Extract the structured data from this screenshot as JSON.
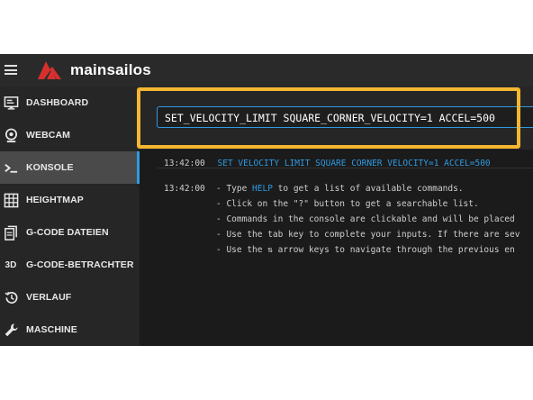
{
  "header": {
    "title": "mainsailos"
  },
  "sidebar": {
    "items": [
      {
        "label": "DASHBOARD",
        "icon": "dashboard-icon"
      },
      {
        "label": "WEBCAM",
        "icon": "webcam-icon"
      },
      {
        "label": "KONSOLE",
        "icon": "console-icon"
      },
      {
        "label": "HEIGHTMAP",
        "icon": "grid-icon"
      },
      {
        "label": "G-CODE DATEIEN",
        "icon": "files-icon"
      },
      {
        "label": "G-CODE-BETRACHTER",
        "icon": "3d-icon",
        "icon_text": "3D"
      },
      {
        "label": "VERLAUF",
        "icon": "history-icon"
      },
      {
        "label": "MASCHINE",
        "icon": "wrench-icon"
      }
    ]
  },
  "console": {
    "input_value": "SET_VELOCITY_LIMIT SQUARE_CORNER_VELOCITY=1 ACCEL=500",
    "entries": [
      {
        "time": "13:42:00",
        "command": "SET_VELOCITY_LIMIT SQUARE_CORNER_VELOCITY=1 ACCEL=500"
      },
      {
        "time": "13:42:00",
        "line1_prefix": "- Type ",
        "line1_kw": "HELP",
        "line1_suffix": " to get a list of available commands.",
        "line2": "- Click on the \"?\" button to get a searchable list.",
        "line3": "- Commands in the console are clickable and will be placed",
        "line4": "- Use the tab key to complete your inputs. If there are sev",
        "line5": "- Use the ⇅ arrow keys to navigate through the previous en"
      }
    ]
  },
  "colors": {
    "accent": "#2f9ae0",
    "highlight": "#f5b731",
    "brand_red": "#d6302d"
  }
}
